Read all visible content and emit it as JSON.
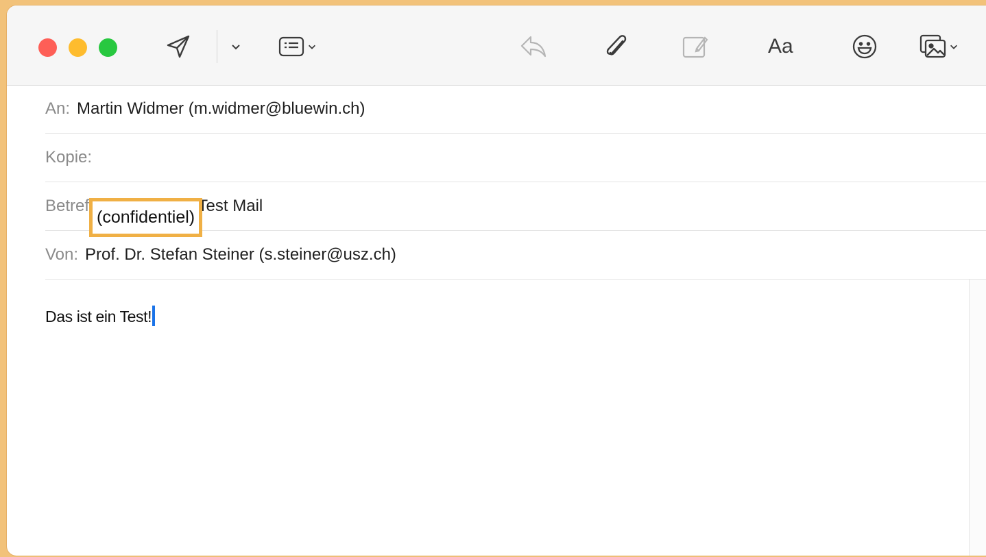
{
  "toolbar": {
    "icons": [
      "send-icon",
      "chevron-down-icon",
      "header-fields-icon",
      "reply-icon",
      "paperclip-icon",
      "markup-icon",
      "format-icon",
      "emoji-icon",
      "photo-browser-icon"
    ],
    "format_label": "Aa"
  },
  "headers": {
    "to_label": "An:",
    "to_value": "Martin Widmer (m.widmer@bluewin.ch)",
    "cc_label": "Kopie:",
    "cc_value": "",
    "subject_label": "Betreff:",
    "subject_value": "(Vertraulich) Test Mail",
    "from_label": "Von:",
    "from_value": "Prof. Dr. Stefan Steiner (s.steiner@usz.ch)"
  },
  "annotation": {
    "text": "(confidentiel)",
    "color": "#f0b045"
  },
  "body": {
    "text": "Das ist ein Test!"
  },
  "colors": {
    "close": "#fe5f57",
    "minimize": "#febc2e",
    "zoom": "#28c840",
    "caret": "#1a73e8"
  }
}
